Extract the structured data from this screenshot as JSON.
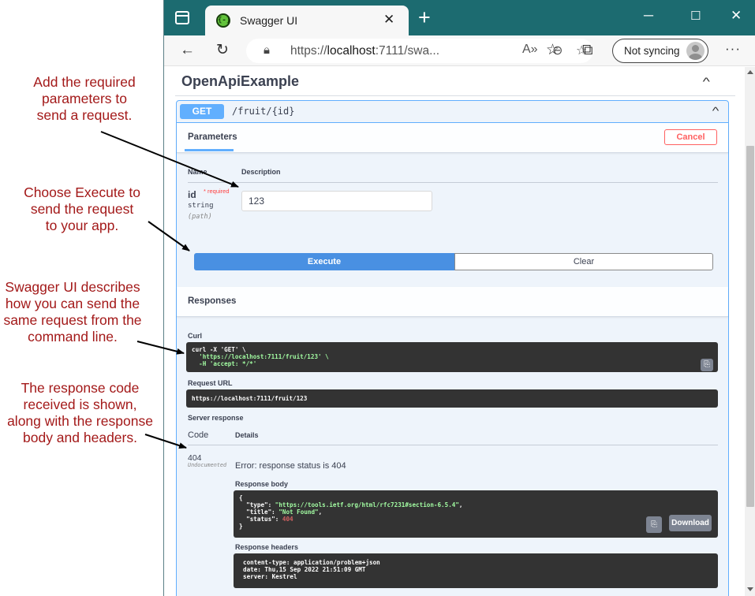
{
  "annotations": {
    "parameters": [
      "Add the required",
      "parameters to",
      "send a request."
    ],
    "execute": [
      "Choose Execute to",
      "send the request",
      "to your app."
    ],
    "curl": [
      "Swagger UI describes",
      "how you can send the",
      "same request from the",
      "command line."
    ],
    "response": [
      "The response code",
      "received is shown,",
      "along with the response",
      "body and headers."
    ]
  },
  "browser": {
    "tab_title": "Swagger UI",
    "favicon_text": "{-}",
    "url_prefix": "https://",
    "url_host": "localhost",
    "url_rest": ":7111/swa...",
    "profile_label": "Not syncing"
  },
  "swagger": {
    "api_title": "OpenApiExample",
    "operation": {
      "method": "GET",
      "path": "/fruit/{id}"
    },
    "parameters": {
      "section_title": "Parameters",
      "cancel_label": "Cancel",
      "col_name": "Name",
      "col_description": "Description",
      "param_name": "id",
      "required_marker": "* required",
      "param_type": "string",
      "param_in": "(path)",
      "param_value": "123",
      "execute_label": "Execute",
      "clear_label": "Clear"
    },
    "responses": {
      "section_title": "Responses",
      "curl_label": "Curl",
      "curl_lines": [
        "curl -X 'GET' \\",
        "  'https://localhost:7111/fruit/123' \\",
        "  -H 'accept: */*'"
      ],
      "request_url_label": "Request URL",
      "request_url": "https://localhost:7111/fruit/123",
      "server_response_label": "Server response",
      "col_code": "Code",
      "col_details": "Details",
      "code": "404",
      "undocumented": "Undocumented",
      "error_text": "Error: response status is 404",
      "body_label": "Response body",
      "body": {
        "open": "{",
        "type_key": "\"type\"",
        "type_val": "\"https://tools.ietf.org/html/rfc7231#section-6.5.4\"",
        "title_key": "\"title\"",
        "title_val": "\"Not Found\"",
        "status_key": "\"status\"",
        "status_val": "404",
        "close": "}"
      },
      "download_label": "Download",
      "headers_label": "Response headers",
      "header_lines": [
        "content-type: application/problem+json",
        "date: Thu,15 Sep 2022 21:51:09 GMT",
        "server: Kestrel"
      ]
    }
  },
  "colors": {
    "annotation": "#a31919",
    "titlebar": "#1c6b70",
    "get_method": "#61affe",
    "execute": "#4990e2",
    "cancel": "#ff6060"
  }
}
